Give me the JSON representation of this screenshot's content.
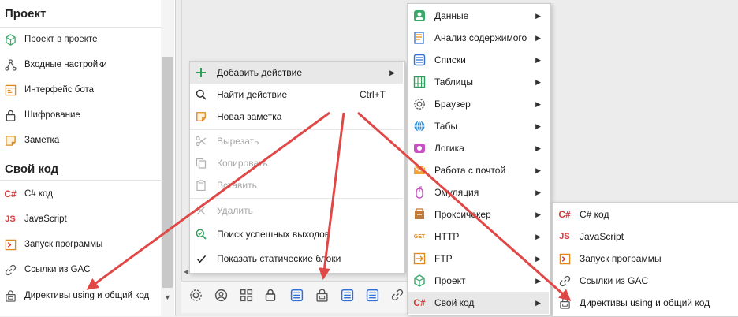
{
  "sidebar": {
    "project_title": "Проект",
    "code_title": "Свой код",
    "project_items": [
      {
        "label": "Проект в проекте",
        "icon": "cube-icon"
      },
      {
        "label": "Входные настройки",
        "icon": "branch-icon"
      },
      {
        "label": "Интерфейс бота",
        "icon": "window-icon"
      },
      {
        "label": "Шифрование",
        "icon": "lock-icon"
      },
      {
        "label": "Заметка",
        "icon": "note-icon"
      }
    ],
    "code_items": [
      {
        "label": "C# код",
        "icon": "csharp-icon",
        "glyph": "C#"
      },
      {
        "label": "JavaScript",
        "icon": "js-icon",
        "glyph": "JS"
      },
      {
        "label": "Запуск программы",
        "icon": "terminal-icon"
      },
      {
        "label": "Ссылки из GAC",
        "icon": "link-icon"
      },
      {
        "label": "Директивы using и общий код",
        "icon": "directives-icon"
      }
    ],
    "scroll_down_glyph": "▼"
  },
  "context_menu": {
    "items": [
      {
        "label": "Добавить действие",
        "icon": "plus-icon",
        "submenu_arrow": "▶",
        "disabled": false
      },
      {
        "label": "Найти действие",
        "icon": "search-icon",
        "shortcut": "Ctrl+T",
        "disabled": false
      },
      {
        "label": "Новая заметка",
        "icon": "note-icon",
        "disabled": false
      },
      {
        "label": "Вырезать",
        "icon": "scissors-icon",
        "disabled": true
      },
      {
        "label": "Копировать",
        "icon": "copy-icon",
        "disabled": true
      },
      {
        "label": "Вставить",
        "icon": "paste-icon",
        "disabled": true
      },
      {
        "label": "Удалить",
        "icon": "delete-icon",
        "disabled": true
      },
      {
        "label": "Поиск успешных выходов",
        "icon": "search-success-icon",
        "disabled": false
      },
      {
        "label": "Показать статические блоки",
        "icon": "checkmark-icon",
        "disabled": false
      }
    ]
  },
  "submenu": {
    "arrow": "▶",
    "items": [
      {
        "label": "Данные",
        "icon": "user-icon"
      },
      {
        "label": "Анализ содержимого",
        "icon": "document-icon"
      },
      {
        "label": "Списки",
        "icon": "list-icon"
      },
      {
        "label": "Таблицы",
        "icon": "table-icon"
      },
      {
        "label": "Браузер",
        "icon": "gear-icon"
      },
      {
        "label": "Табы",
        "icon": "globe-icon"
      },
      {
        "label": "Логика",
        "icon": "logic-icon"
      },
      {
        "label": "Работа с почтой",
        "icon": "mail-icon"
      },
      {
        "label": "Эмуляция",
        "icon": "mouse-icon"
      },
      {
        "label": "Проксичекер",
        "icon": "proxy-icon"
      },
      {
        "label": "HTTP",
        "icon": "http-icon",
        "glyph": "GET"
      },
      {
        "label": "FTP",
        "icon": "ftp-icon"
      },
      {
        "label": "Проект",
        "icon": "cube-icon"
      },
      {
        "label": "Свой код",
        "icon": "csharp-icon",
        "glyph": "C#"
      }
    ]
  },
  "subsubmenu": {
    "items": [
      {
        "label": "C# код",
        "icon": "csharp-icon",
        "glyph": "C#"
      },
      {
        "label": "JavaScript",
        "icon": "js-icon",
        "glyph": "JS"
      },
      {
        "label": "Запуск программы",
        "icon": "terminal-icon"
      },
      {
        "label": "Ссылки из GAC",
        "icon": "link-icon"
      },
      {
        "label": "Директивы using и общий код",
        "icon": "directives-icon"
      }
    ]
  },
  "toolbar": {
    "left_arrow": "◀",
    "icons": [
      "gear-icon",
      "user-circle-icon",
      "grid-icon",
      "lock-icon",
      "list-icon",
      "directives-icon",
      "list-icon",
      "list-icon",
      "link-icon"
    ]
  },
  "colors": {
    "accent_green": "#2e9e5b",
    "accent_orange": "#e88a1a",
    "accent_red": "#d83b3b",
    "arrow_red": "#e04848",
    "highlight": "#e8e8e8"
  }
}
